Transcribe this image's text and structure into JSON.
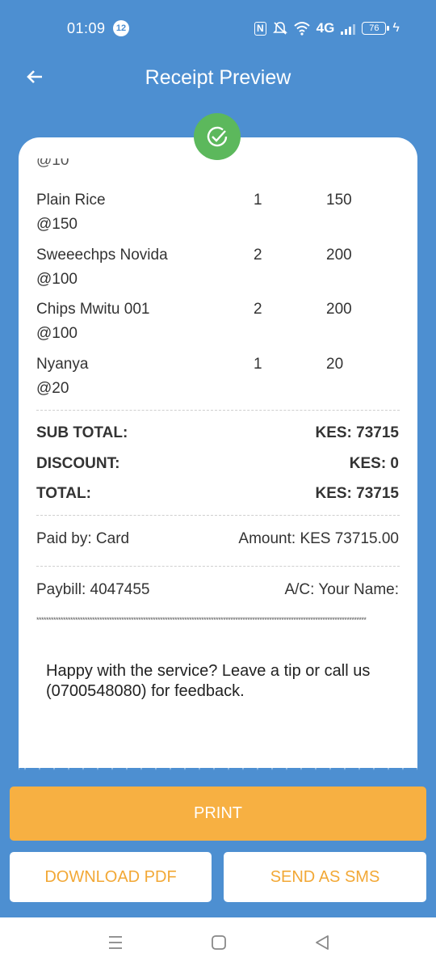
{
  "status_bar": {
    "time": "01:09",
    "notification_count": "12",
    "network": "4G",
    "battery": "76"
  },
  "header": {
    "title": "Receipt Preview"
  },
  "receipt": {
    "cut_off_text": "@10",
    "items": [
      {
        "name": "Plain Rice",
        "unit_price": "@150",
        "qty": "1",
        "amount": "150"
      },
      {
        "name": "Sweeechps Novida",
        "unit_price": "@100",
        "qty": "2",
        "amount": "200"
      },
      {
        "name": "Chips Mwitu 001",
        "unit_price": "@100",
        "qty": "2",
        "amount": "200"
      },
      {
        "name": "Nyanya",
        "unit_price": "@20",
        "qty": "1",
        "amount": "20"
      }
    ],
    "subtotal_label": "SUB TOTAL:",
    "subtotal_value": "KES: 73715",
    "discount_label": "DISCOUNT:",
    "discount_value": "KES: 0",
    "total_label": "TOTAL:",
    "total_value": "KES: 73715",
    "paid_by": "Paid by: Card",
    "amount_paid": "Amount: KES 73715.00",
    "paybill": "Paybill: 4047455",
    "account": "A/C: Your Name:",
    "separator": "****************************************************************************************************************************************",
    "feedback": "Happy with the service? Leave a tip or call us (0700548080) for feedback."
  },
  "actions": {
    "print_label": "PRINT",
    "download_label": "DOWNLOAD PDF",
    "sms_label": "SEND AS SMS"
  },
  "colors": {
    "background": "#4d8fd1",
    "accent": "#f7b042",
    "success": "#5cb85c"
  }
}
